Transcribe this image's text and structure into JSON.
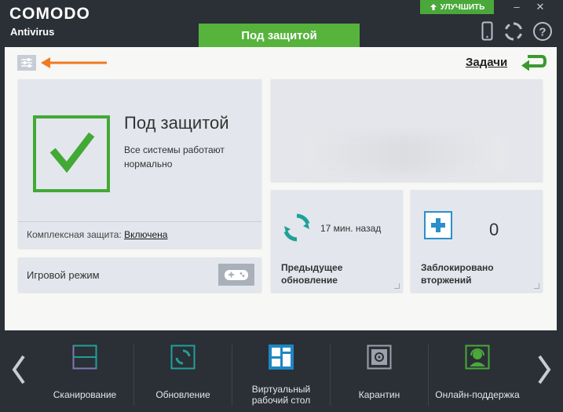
{
  "app": {
    "logo": "COMODO",
    "product": "Antivirus",
    "upgrade_label": "УЛУЧШИТЬ",
    "status_tab": "Под защитой"
  },
  "window_controls": {
    "minimize": "–",
    "close": "✕"
  },
  "header": {
    "tasks_label": "Задачи"
  },
  "status_card": {
    "title": "Под защитой",
    "description": "Все системы работают нормально",
    "protection_label": "Комплексная защита:",
    "protection_value": "Включена"
  },
  "game_mode": {
    "label": "Игровой режим"
  },
  "update_card": {
    "time": "17 мин. назад",
    "label_line1": "Предыдущее",
    "label_line2": "обновление"
  },
  "blocked_card": {
    "count": "0",
    "label_line1": "Заблокировано",
    "label_line2": "вторжений"
  },
  "toolbar": {
    "items": [
      {
        "label": "Сканирование",
        "icon": "scan-icon"
      },
      {
        "label": "Обновление",
        "icon": "update-icon"
      },
      {
        "label_line1": "Виртуальный",
        "label_line2": "рабочий стол",
        "icon": "virtual-desktop-icon"
      },
      {
        "label": "Карантин",
        "icon": "quarantine-icon"
      },
      {
        "label": "Онлайн-поддержка",
        "icon": "online-support-icon"
      }
    ]
  },
  "colors": {
    "accent_green": "#56b33c",
    "status_green": "#42a935",
    "accent_orange": "#f07a1e",
    "teal": "#1fa09a",
    "blue": "#2b8fc9",
    "background_dark": "#2b2f36"
  }
}
